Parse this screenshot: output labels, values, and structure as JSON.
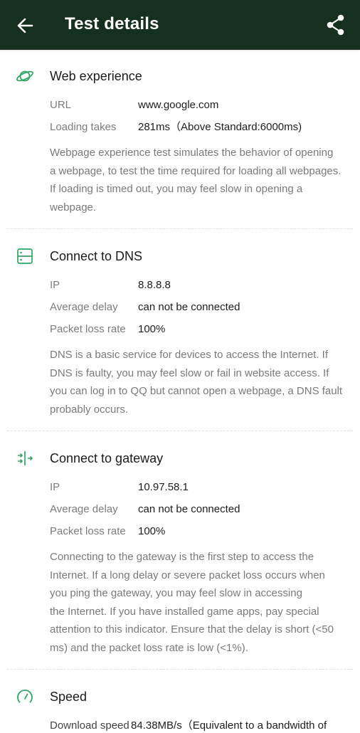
{
  "header": {
    "title": "Test details",
    "back_icon": "arrow-left-icon",
    "share_icon": "share-icon"
  },
  "accent_color": "#2fa661",
  "sections": [
    {
      "title": "Web experience",
      "icon": "planet-icon",
      "rows": [
        {
          "label": "URL",
          "value": "www.google.com"
        },
        {
          "label": "Loading takes",
          "value": "281ms（Above Standard:6000ms)"
        }
      ],
      "desc": [
        "Webpage experience test simulates the behavior of opening",
        "a webpage, to test the time required for loading all webpages.",
        "If loading is timed out, you may feel slow in opening a",
        "webpage."
      ]
    },
    {
      "title": "Connect to DNS",
      "icon": "server-icon",
      "rows": [
        {
          "label": "IP",
          "value": "8.8.8.8"
        },
        {
          "label": "Average delay",
          "value": "can not be connected"
        },
        {
          "label": "Packet loss rate",
          "value": "100%"
        }
      ],
      "desc": [
        "DNS is a basic service for devices to access the Internet. If",
        "DNS is faulty, you may feel slow or fail in website access. If",
        "you can log in to QQ but cannot open a webpage, a DNS fault",
        "probably occurs."
      ]
    },
    {
      "title": "Connect to gateway",
      "icon": "gateway-icon",
      "rows": [
        {
          "label": "IP",
          "value": "10.97.58.1"
        },
        {
          "label": "Average delay",
          "value": "can not be connected"
        },
        {
          "label": "Packet loss rate",
          "value": "100%"
        }
      ],
      "desc": [
        "Connecting to the gateway is the first step to access the",
        "Internet. If a long delay or severe packet loss occurs when",
        "you ping the gateway, you may feel slow in accessing",
        "the Internet. If you have installed game apps, pay special",
        "attention to this indicator. Ensure that the delay is short (<50",
        "ms) and the packet loss rate is low (<1%)."
      ]
    },
    {
      "title": "Speed",
      "icon": "speedometer-icon",
      "rows": [
        {
          "label": "Download speed",
          "value": "84.38MB/s（Equivalent to a bandwidth of"
        }
      ]
    }
  ]
}
